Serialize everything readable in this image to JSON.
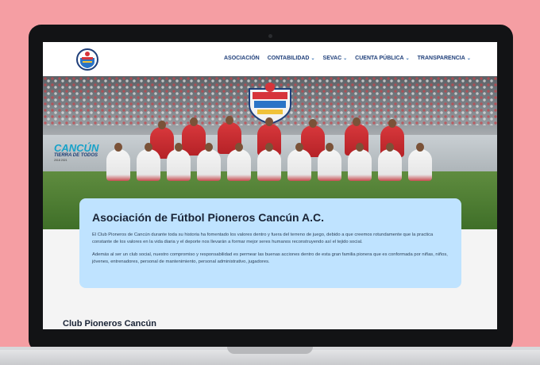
{
  "site": {
    "nav": {
      "items": [
        {
          "label": "ASOCIACIÓN",
          "dropdown": false
        },
        {
          "label": "CONTABILIDAD",
          "dropdown": true
        },
        {
          "label": "SEVAC",
          "dropdown": true
        },
        {
          "label": "CUENTA PÚBLICA",
          "dropdown": true
        },
        {
          "label": "TRANSPARENCIA",
          "dropdown": true
        }
      ],
      "chevron_glyph": "⌄"
    },
    "hero": {
      "banner_title": "CANCÚN",
      "banner_sub": "TIERRA DE TODOS",
      "banner_years": "2018    2021"
    },
    "intro": {
      "title": "Asociación de Fútbol Pioneros Cancún A.C.",
      "paragraph_1": "El Club Pioneros de Cancún durante toda su historia ha fomentado los valores dentro y fuera del terreno de juego, debido a que creemos rotundamente que la practica constante de los valores en la vida diaria y el deporte nos llevarán a formar mejor seres humanos reconstruyendo así el tejido social.",
      "paragraph_2": "Además al ser un club social, nuestro compromiso y responsabilidad es permear las buenas acciones dentro de esta gran familia pionera que es conformada por niñas, niños, jóvenes, entrenadores, personal de mantenimiento, personal administrativo, jugadores."
    },
    "section_title": "Club Pioneros Cancún"
  },
  "colors": {
    "background": "#f59ea3",
    "nav_text": "#1f3f7a",
    "card_bg": "#bfe3ff",
    "accent": "#17a2c9"
  },
  "icons": {
    "logo": "club-crest-icon",
    "chevron": "chevron-down-icon"
  }
}
